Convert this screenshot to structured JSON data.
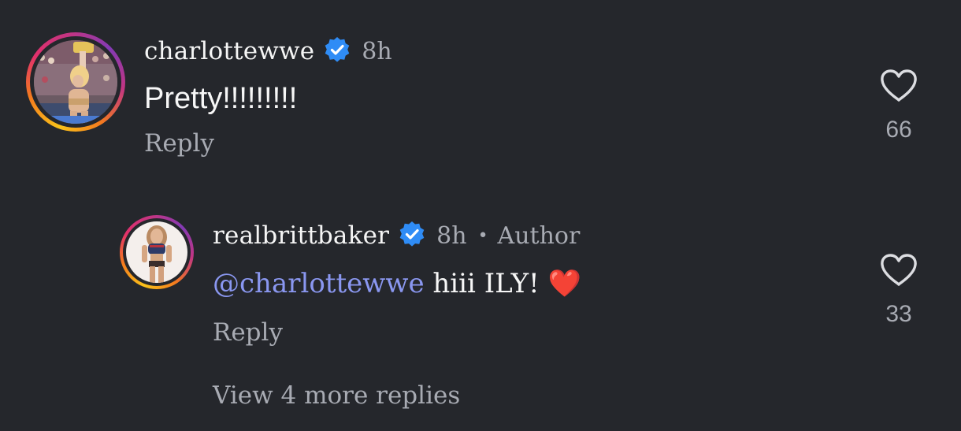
{
  "comments": [
    {
      "username": "charlottewwe",
      "time": "8h",
      "text": "Pretty!!!!!!!!!",
      "reply_label": "Reply",
      "likes": "66"
    },
    {
      "username": "realbrittbaker",
      "time": "8h",
      "separator": "•",
      "author_label": "Author",
      "mention": "@charlottewwe",
      "text": " hiii ILY! ",
      "emoji": "❤️",
      "reply_label": "Reply",
      "likes": "33"
    }
  ],
  "view_more_label": "View 4 more replies",
  "colors": {
    "background": "#25272c",
    "verified": "#2f8cf6",
    "mention": "#8a97f0",
    "muted": "#a8abb3"
  }
}
